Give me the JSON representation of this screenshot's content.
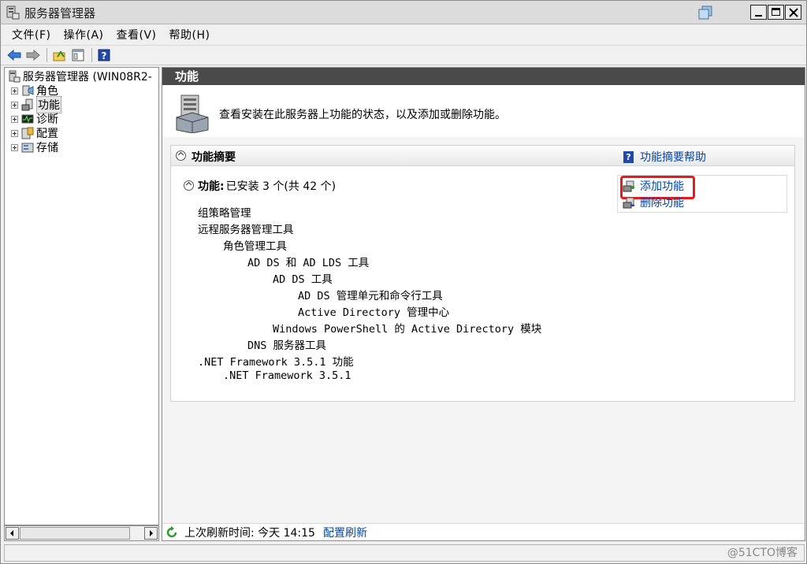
{
  "window": {
    "title": "服务器管理器"
  },
  "menu": [
    "文件(F)",
    "操作(A)",
    "查看(V)",
    "帮助(H)"
  ],
  "tree": {
    "root": "服务器管理器 (WIN08R2-",
    "items": [
      "角色",
      "功能",
      "诊断",
      "配置",
      "存储"
    ]
  },
  "right": {
    "header": "功能",
    "intro": "查看安装在此服务器上功能的状态，以及添加或删除功能。",
    "summary_title": "功能摘要",
    "help_link": "功能摘要帮助",
    "features_label": "功能:",
    "features_value": "已安装 3 个(共 42 个)",
    "add_feature": "添加功能",
    "remove_feature": "删除功能",
    "feature_list": [
      "组策略管理",
      "远程服务器管理工具",
      "角色管理工具",
      "AD DS 和 AD LDS 工具",
      "AD DS 工具",
      "AD DS 管理单元和命令行工具",
      "Active Directory 管理中心",
      "Windows PowerShell 的 Active Directory 模块",
      "DNS 服务器工具",
      ".NET Framework 3.5.1 功能",
      ".NET Framework 3.5.1"
    ],
    "last_refresh": "上次刷新时间: 今天 14:15",
    "configure_refresh": "配置刷新"
  },
  "watermark": "@51CTO博客"
}
